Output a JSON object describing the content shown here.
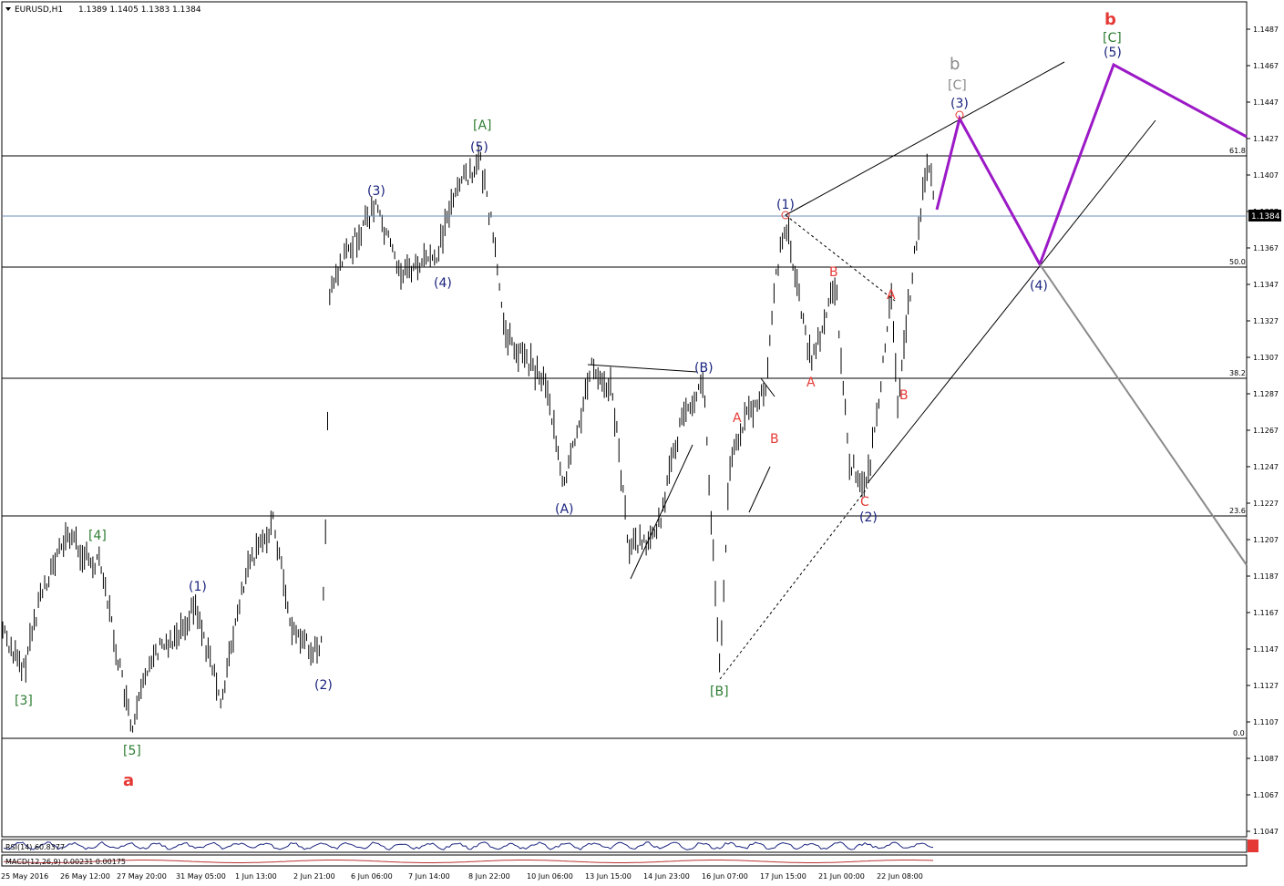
{
  "header": {
    "symbol": "EURUSD,H1",
    "ohlc": "1.1389 1.1405 1.1383 1.1384"
  },
  "colors": {
    "wave_blue": "#1a237e",
    "wave_green": "#2e7d32",
    "wave_red": "#e53935",
    "wave_gray": "#8a8a8a",
    "projection": "#9b19c6",
    "bar": "#000000"
  },
  "price_axis": {
    "ticks": [
      "1.1487",
      "1.1467",
      "1.1447",
      "1.1427",
      "1.1407",
      "1.1387",
      "1.1367",
      "1.1347",
      "1.1327",
      "1.1307",
      "1.1287",
      "1.1267",
      "1.1247",
      "1.1227",
      "1.1207",
      "1.1187",
      "1.1167",
      "1.1147",
      "1.1127",
      "1.1107",
      "1.1087",
      "1.1067",
      "1.1047"
    ],
    "current": "1.1384"
  },
  "time_axis": [
    "25 May 2016",
    "26 May 12:00",
    "27 May 20:00",
    "31 May 05:00",
    "1 Jun 13:00",
    "2 Jun 21:00",
    "6 Jun 06:00",
    "7 Jun 14:00",
    "8 Jun 22:00",
    "10 Jun 06:00",
    "13 Jun 15:00",
    "14 Jun 23:00",
    "16 Jun 07:00",
    "17 Jun 15:00",
    "21 Jun 00:00",
    "22 Jun 08:00"
  ],
  "fib_levels": [
    "61.8",
    "50.0",
    "38.2",
    "23.6",
    "0.0"
  ],
  "wave_labels": {
    "big_a": "a",
    "big_b": "b",
    "g3": "[3]",
    "g4": "[4]",
    "g5": "[5]",
    "gA": "[A]",
    "gB": "[B]",
    "gC": "[C]",
    "grayC": "[C]",
    "gray_b": "b",
    "p1a": "(1)",
    "p2a": "(2)",
    "p3a": "(3)",
    "p4a": "(4)",
    "p5a": "(5)",
    "pA": "(A)",
    "pB": "(B)",
    "p1b": "(1)",
    "p2b": "(2)",
    "p3b": "(3)",
    "p4b": "(4)",
    "p5b": "(5)",
    "rA1": "A",
    "rB1": "B",
    "rA2": "A",
    "rB2": "B",
    "rA3": "A",
    "rB3": "B",
    "rC3": "C",
    "rA4": "A",
    "rB4": "B",
    "rC4": "C"
  },
  "indicators": {
    "rsi": "RSI(14) 60.8377",
    "macd": "MACD(12,26,9) 0.00231 0.00175"
  }
}
